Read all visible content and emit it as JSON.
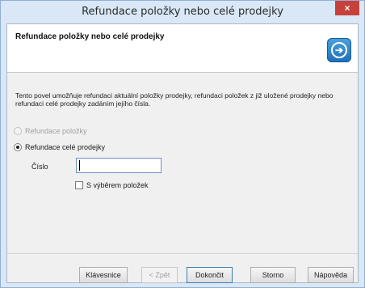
{
  "window": {
    "title": "Refundace položky nebo celé prodejky",
    "close_label": "×"
  },
  "header": {
    "title": "Refundace položky nebo celé prodejky",
    "icon": "wizard-forward-icon",
    "icon_glyph": "➔"
  },
  "description": "Tento povel umožňuje refundaci aktuální položky prodejky, refundaci položek z již uložené prodejky nebo refundaci celé prodejky zadáním jejího čísla.",
  "options": {
    "refund_item": {
      "label": "Refundace položky",
      "enabled": false,
      "selected": false
    },
    "refund_receipt": {
      "label": "Refundace celé prodejky",
      "enabled": true,
      "selected": true
    }
  },
  "number_field": {
    "label": "Číslo",
    "value": ""
  },
  "item_selection": {
    "label": "S výběrem položek",
    "checked": false
  },
  "buttons": {
    "keyboard": "Klávesnice",
    "back": "< Zpět",
    "finish": "Dokončit",
    "cancel": "Storno",
    "help": "Nápověda"
  },
  "colors": {
    "title_bar": "#d9e7f6",
    "close_button": "#c7413b",
    "icon_blue": "#1d6fb8"
  }
}
